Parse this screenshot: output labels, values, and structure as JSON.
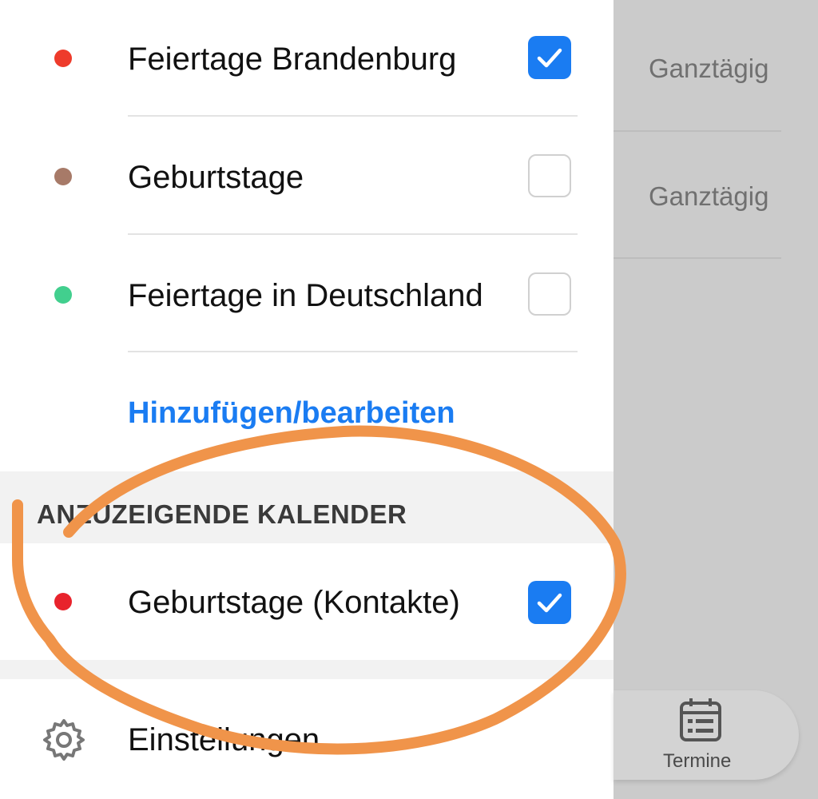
{
  "calendars": [
    {
      "label": "Feiertage Brandenburg",
      "color": "#ee3b2b",
      "checked": true
    },
    {
      "label": "Geburtstage",
      "color": "#a77a68",
      "checked": false
    },
    {
      "label": "Feiertage in Deutschland",
      "color": "#42cf8e",
      "checked": false
    }
  ],
  "add_edit_link": "Hinzufügen/bearbeiten",
  "section": {
    "title": "ANZUZEIGENDE KALENDER",
    "items": [
      {
        "label": "Geburtstage (Kontakte)",
        "color": "#e8232c",
        "checked": true
      }
    ]
  },
  "settings": {
    "label": "Einstellungen",
    "icon": "gear-icon"
  },
  "background": {
    "allday_labels": [
      "Ganztägig",
      "Ganztägig"
    ],
    "nav": {
      "label": "Termine",
      "icon": "calendar-list-icon"
    }
  },
  "colors": {
    "accent": "#1a7cf2",
    "annotation": "#f0944a"
  }
}
